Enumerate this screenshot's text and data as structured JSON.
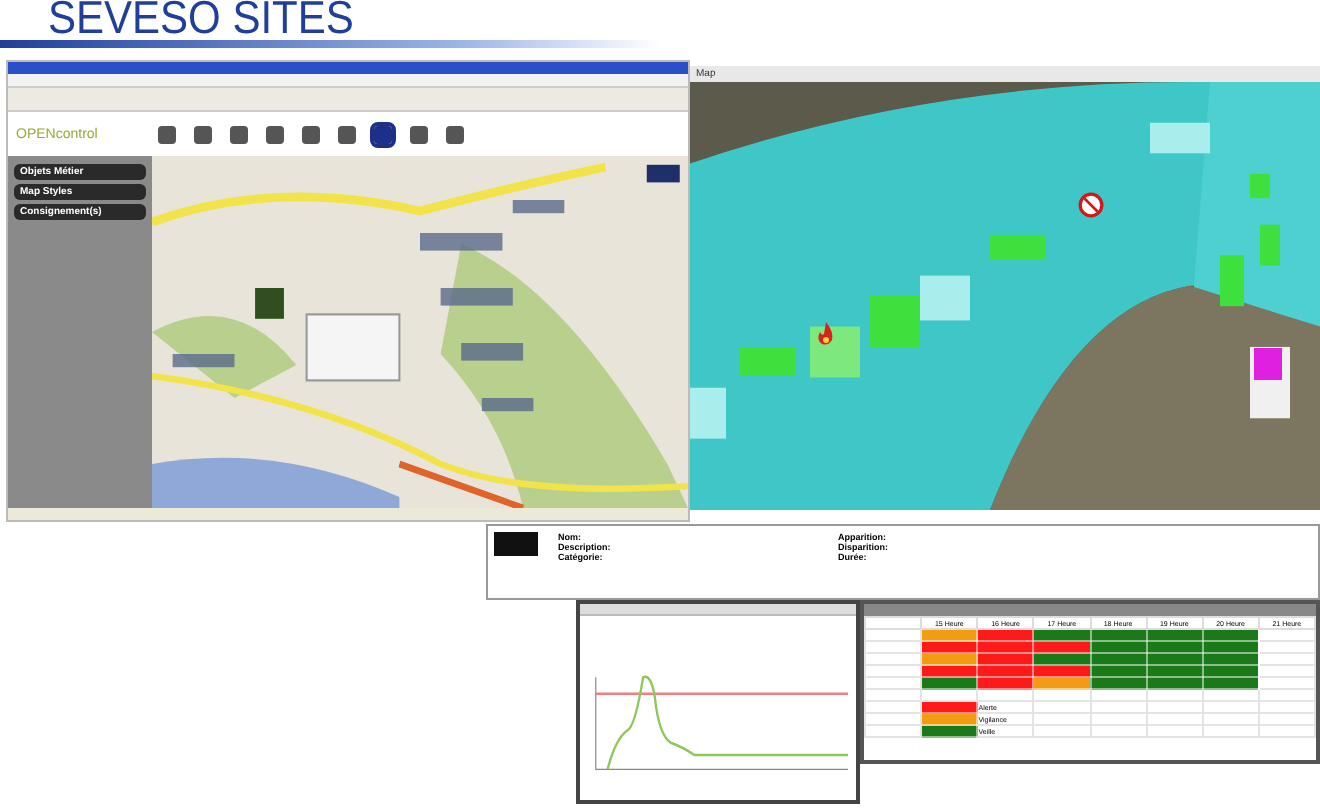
{
  "slide": {
    "title": "SEVESO SITES"
  },
  "app_window": {
    "logo": "OPENcontrol",
    "sidebar": {
      "items": [
        {
          "label": "Objets Métier"
        },
        {
          "label": "Map Styles"
        },
        {
          "label": "Consignement(s)"
        }
      ]
    }
  },
  "map_window": {
    "title": "Map"
  },
  "details": {
    "left": [
      {
        "label": "Nom:"
      },
      {
        "label": "Description:"
      },
      {
        "label": "Catégorie:"
      }
    ],
    "right": [
      {
        "label": "Apparition:"
      },
      {
        "label": "Disparition:"
      },
      {
        "label": "Durée:"
      }
    ]
  },
  "grid_window": {
    "columns": [
      "15 Heure",
      "16 Heure",
      "17 Heure",
      "18 Heure",
      "19 Heure",
      "20 Heure",
      "21 Heure"
    ],
    "rows": [
      {
        "cells": [
          {
            "color": "#f39c12"
          },
          {
            "color": "#ff1a1a"
          },
          {
            "color": "#1a7a1a"
          },
          {
            "color": "#1a7a1a"
          },
          {
            "color": "#1a7a1a"
          },
          {
            "color": "#1a7a1a"
          }
        ]
      },
      {
        "cells": [
          {
            "color": "#ff1a1a"
          },
          {
            "color": "#ff1a1a"
          },
          {
            "color": "#ff1a1a"
          },
          {
            "color": "#1a7a1a"
          },
          {
            "color": "#1a7a1a"
          },
          {
            "color": "#1a7a1a"
          }
        ]
      },
      {
        "cells": [
          {
            "color": "#f39c12"
          },
          {
            "color": "#ff1a1a"
          },
          {
            "color": "#1a7a1a"
          },
          {
            "color": "#1a7a1a"
          },
          {
            "color": "#1a7a1a"
          },
          {
            "color": "#1a7a1a"
          }
        ]
      },
      {
        "cells": [
          {
            "color": "#ff1a1a"
          },
          {
            "color": "#ff1a1a"
          },
          {
            "color": "#ff1a1a"
          },
          {
            "color": "#1a7a1a"
          },
          {
            "color": "#1a7a1a"
          },
          {
            "color": "#1a7a1a"
          }
        ]
      },
      {
        "cells": [
          {
            "color": "#1a7a1a"
          },
          {
            "color": "#ff1a1a"
          },
          {
            "color": "#f39c12"
          },
          {
            "color": "#1a7a1a"
          },
          {
            "color": "#1a7a1a"
          },
          {
            "color": "#1a7a1a"
          }
        ]
      }
    ],
    "legend": [
      {
        "label": "Alerte",
        "color": "#ff1a1a"
      },
      {
        "label": "Vigilance",
        "color": "#f39c12"
      },
      {
        "label": "Veille",
        "color": "#1a7a1a"
      }
    ]
  }
}
